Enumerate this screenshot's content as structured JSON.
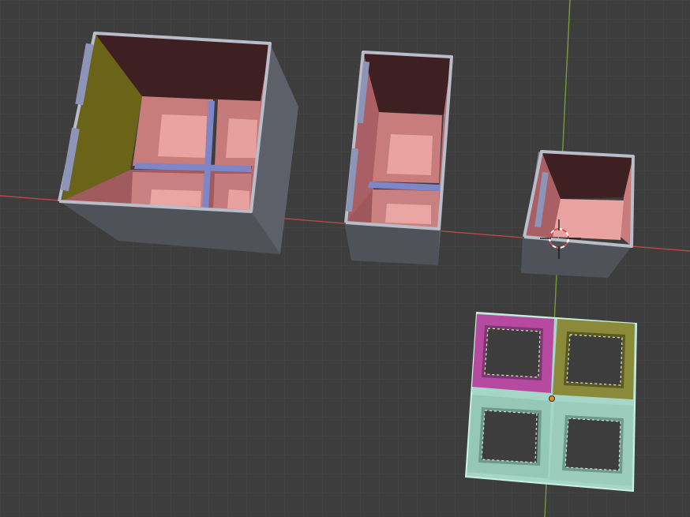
{
  "viewport": {
    "name": "3D Viewport",
    "background": "#3d3d3d",
    "grid_minor_color": "#474747",
    "grid_major_color": "#4f4f4f",
    "x_axis_color": "#b44a4a",
    "y_axis_color": "#7a9a3a"
  },
  "objects": [
    {
      "id": "large-box",
      "kind": "box-with-2x2-dividers",
      "state": "unselected"
    },
    {
      "id": "medium-box",
      "kind": "box-with-1x2-dividers",
      "state": "unselected"
    },
    {
      "id": "small-box",
      "kind": "open-box",
      "state": "unselected"
    },
    {
      "id": "divider-insert",
      "kind": "2x2-frame-grid",
      "state": "selected",
      "active_face_colors": [
        "#b64aa0",
        "#8a8a3a"
      ],
      "selection_color": "#a6d6c8"
    }
  ],
  "colors": {
    "box_outer": "#7e808c",
    "box_side_dark": "#5b5d66",
    "box_rim": "#b9bdc9",
    "box_inner_back": "#3e1f22",
    "box_inner_pink": "#c97c7c",
    "box_floor": "#e9a3a0",
    "divider_blue": "#7f86c8",
    "highlight_yellow": "#6b6318",
    "cursor_red": "#d64a4a"
  }
}
